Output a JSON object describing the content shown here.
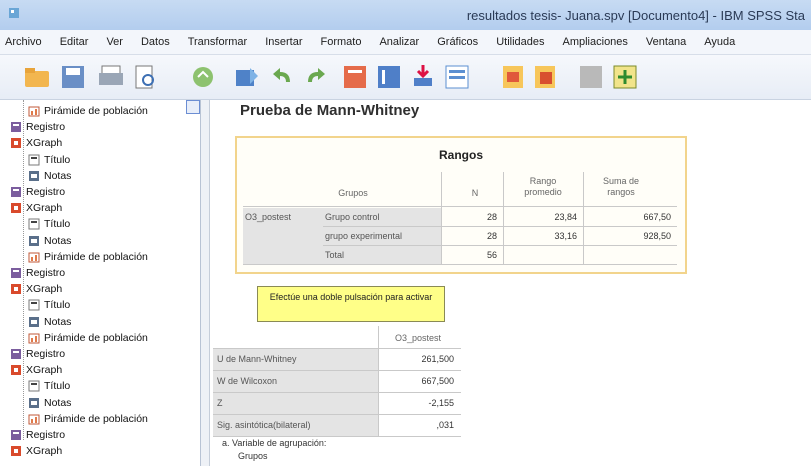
{
  "window": {
    "title": "resultados tesis- Juana.spv [Documento4] - IBM SPSS Sta"
  },
  "menu": [
    "Archivo",
    "Editar",
    "Ver",
    "Datos",
    "Transformar",
    "Insertar",
    "Formato",
    "Analizar",
    "Gráficos",
    "Utilidades",
    "Ampliaciones",
    "Ventana",
    "Ayuda"
  ],
  "toolbar": {
    "buttons": [
      "open-folder",
      "save",
      "print",
      "print-preview",
      "recall-dialog",
      "export",
      "undo",
      "redo",
      "goto-case",
      "goto-variable",
      "insert-cases",
      "variables",
      "designate-window",
      "show-all",
      "promote",
      "run-script"
    ]
  },
  "outline": {
    "items": [
      {
        "label": "Pirámide de población",
        "icon": "chart-icon",
        "level": 2
      },
      {
        "label": "Registro",
        "icon": "log-icon",
        "level": 1
      },
      {
        "label": "XGraph",
        "icon": "xgraph-icon",
        "level": 1
      },
      {
        "label": "Título",
        "icon": "title-icon",
        "level": 2
      },
      {
        "label": "Notas",
        "icon": "notes-icon",
        "level": 2
      },
      {
        "label": "Registro",
        "icon": "log-icon",
        "level": 1
      },
      {
        "label": "XGraph",
        "icon": "xgraph-icon",
        "level": 1
      },
      {
        "label": "Título",
        "icon": "title-icon",
        "level": 2
      },
      {
        "label": "Notas",
        "icon": "notes-icon",
        "level": 2
      },
      {
        "label": "Pirámide de población",
        "icon": "chart-icon",
        "level": 2
      },
      {
        "label": "Registro",
        "icon": "log-icon",
        "level": 1
      },
      {
        "label": "XGraph",
        "icon": "xgraph-icon",
        "level": 1
      },
      {
        "label": "Título",
        "icon": "title-icon",
        "level": 2
      },
      {
        "label": "Notas",
        "icon": "notes-icon",
        "level": 2
      },
      {
        "label": "Pirámide de población",
        "icon": "chart-icon",
        "level": 2
      },
      {
        "label": "Registro",
        "icon": "log-icon",
        "level": 1
      },
      {
        "label": "XGraph",
        "icon": "xgraph-icon",
        "level": 1
      },
      {
        "label": "Título",
        "icon": "title-icon",
        "level": 2
      },
      {
        "label": "Notas",
        "icon": "notes-icon",
        "level": 2
      },
      {
        "label": "Pirámide de población",
        "icon": "chart-icon",
        "level": 2
      },
      {
        "label": "Registro",
        "icon": "log-icon",
        "level": 1
      },
      {
        "label": "XGraph",
        "icon": "xgraph-icon",
        "level": 1
      }
    ]
  },
  "content": {
    "heading": "Prueba de Mann-Whitney",
    "ranks": {
      "title": "Rangos",
      "col_headers": [
        "Grupos",
        "N",
        "Rango promedio",
        "Suma de rangos"
      ],
      "row_var": "O3_postest",
      "rows": [
        {
          "group": "Grupo control",
          "n": "28",
          "mean_rank": "23,84",
          "sum_ranks": "667,50"
        },
        {
          "group": "grupo experimental",
          "n": "28",
          "mean_rank": "33,16",
          "sum_ranks": "928,50"
        },
        {
          "group": "Total",
          "n": "56",
          "mean_rank": "",
          "sum_ranks": ""
        }
      ]
    },
    "tooltip": "Efectúe una doble pulsación para activar",
    "stats": {
      "col_header": "O3_postest",
      "rows": [
        {
          "label": "U de Mann-Whitney",
          "value": "261,500"
        },
        {
          "label": "W de Wilcoxon",
          "value": "667,500"
        },
        {
          "label": "Z",
          "value": "-2,155"
        },
        {
          "label": "Sig. asintótica(bilateral)",
          "value": ",031"
        }
      ],
      "footnote_1": "a. Variable de agrupación:",
      "footnote_2": "Grupos"
    }
  },
  "colors": {
    "titlebar": "#b3cdee",
    "table_border": "#f2d48c",
    "tooltip_bg": "#ffff88"
  }
}
